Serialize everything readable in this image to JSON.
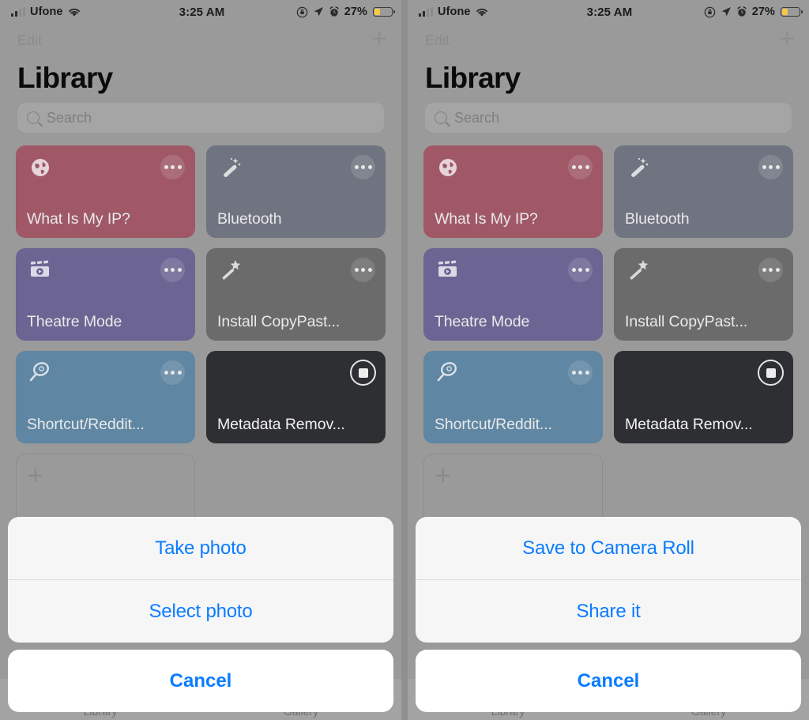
{
  "status_bar": {
    "carrier": "Ufone",
    "wifi_icon": "wifi-icon",
    "time": "3:25 AM",
    "rotation_lock_icon": "rotation-lock-icon",
    "location_icon": "location-arrow-icon",
    "alarm_icon": "alarm-clock-icon",
    "battery_percent": "27%",
    "battery_level": 27,
    "battery_color": "#f7c948"
  },
  "nav": {
    "edit_label": "Edit",
    "add_icon": "plus-icon"
  },
  "page_title": "Library",
  "search": {
    "placeholder": "Search",
    "icon": "search-icon"
  },
  "cards": [
    {
      "title": "What Is My IP?",
      "icon": "globe-icon",
      "color": "#a05867",
      "menu": "more-options-icon"
    },
    {
      "title": "Bluetooth",
      "icon": "magic-wand-icon",
      "color": "#6f7480",
      "menu": "more-options-icon"
    },
    {
      "title": "Theatre Mode",
      "icon": "film-clapper-icon",
      "color": "#6c6593",
      "menu": "more-options-icon"
    },
    {
      "title": "Install CopyPast...",
      "icon": "magic-wand-star-icon",
      "color": "#6b6b6b",
      "menu": "more-options-icon"
    },
    {
      "title": "Shortcut/Reddit...",
      "icon": "magnifier-icon",
      "color": "#5f86a2",
      "menu": "more-options-icon"
    },
    {
      "title": "Metadata Remov...",
      "icon": "none",
      "color": "#2e2f33",
      "menu": "stop-icon",
      "running": true
    }
  ],
  "add_card": {
    "icon": "plus-icon"
  },
  "tabs": [
    {
      "label": "Library"
    },
    {
      "label": "Gallery"
    }
  ],
  "sheets": {
    "left": {
      "options": [
        {
          "label": "Take photo"
        },
        {
          "label": "Select photo"
        }
      ],
      "cancel_label": "Cancel"
    },
    "right": {
      "options": [
        {
          "label": "Save to Camera Roll"
        },
        {
          "label": "Share it"
        }
      ],
      "cancel_label": "Cancel"
    }
  },
  "colors": {
    "accent": "#0a7cff",
    "dimmed_background": "#9a9a9a",
    "sheet_background": "#f6f6f7",
    "cancel_background": "#ffffff"
  }
}
